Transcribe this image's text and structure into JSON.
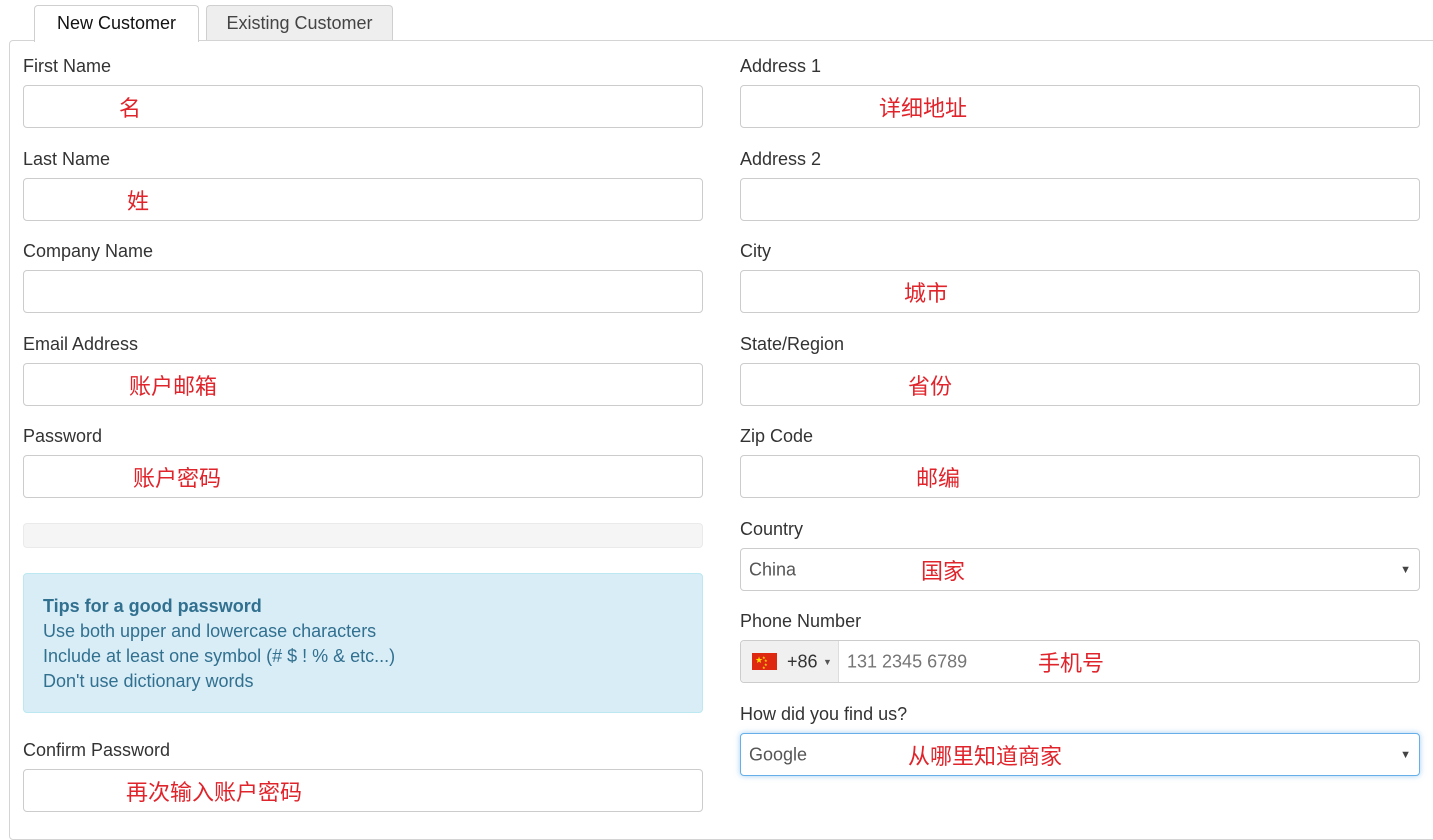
{
  "tabs": [
    {
      "label": "New Customer",
      "active": true
    },
    {
      "label": "Existing Customer",
      "active": false
    }
  ],
  "left": {
    "first_name": {
      "label": "First Name",
      "annotation": "名"
    },
    "last_name": {
      "label": "Last Name",
      "annotation": "姓"
    },
    "company_name": {
      "label": "Company Name",
      "annotation": ""
    },
    "email": {
      "label": "Email Address",
      "annotation": "账户邮箱"
    },
    "password": {
      "label": "Password",
      "annotation": "账户密码"
    },
    "confirm_password": {
      "label": "Confirm Password",
      "annotation": "再次输入账户密码"
    }
  },
  "tips": {
    "title": "Tips for a good password",
    "lines": [
      "Use both upper and lowercase characters",
      "Include at least one symbol (# $ ! % & etc...)",
      "Don't use dictionary words"
    ]
  },
  "right": {
    "address1": {
      "label": "Address 1",
      "annotation": "详细地址"
    },
    "address2": {
      "label": "Address 2",
      "annotation": ""
    },
    "city": {
      "label": "City",
      "annotation": "城市"
    },
    "state": {
      "label": "State/Region",
      "annotation": "省份"
    },
    "zip": {
      "label": "Zip Code",
      "annotation": "邮编"
    },
    "country": {
      "label": "Country",
      "value": "China",
      "annotation": "国家"
    },
    "phone": {
      "label": "Phone Number",
      "dial_code": "+86",
      "placeholder": "131 2345 6789",
      "annotation": "手机号",
      "flag_icon": "china-flag-icon"
    },
    "find_us": {
      "label": "How did you find us?",
      "value": "Google",
      "annotation": "从哪里知道商家"
    }
  },
  "colors": {
    "annotation": "#e0242b",
    "tips_bg": "#d9edf7",
    "tips_text": "#31708f",
    "focus_border": "#66afe9"
  }
}
